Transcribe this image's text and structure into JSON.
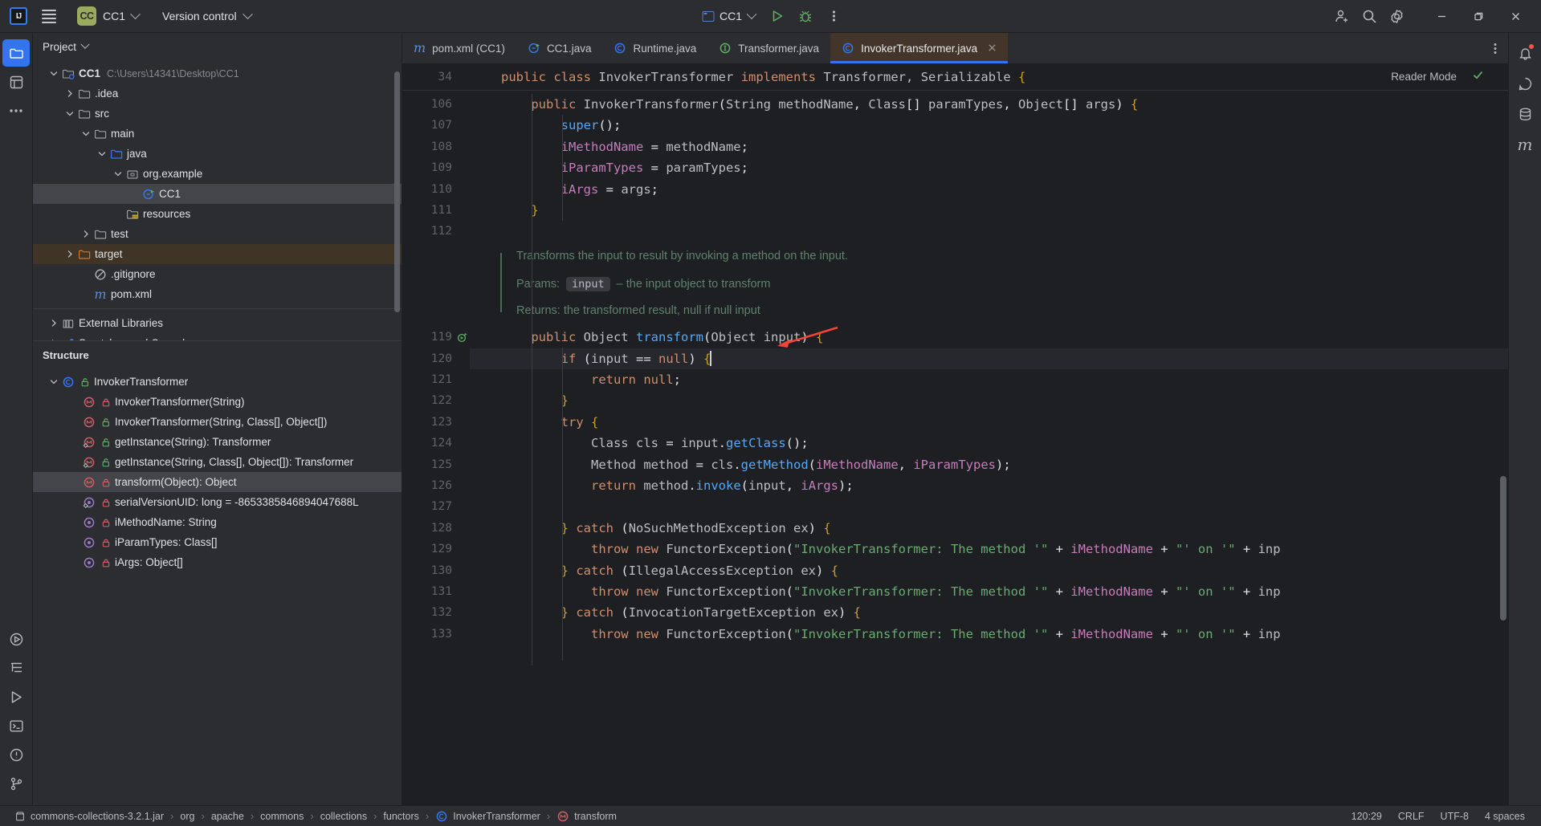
{
  "toolbar": {
    "logo": "intellij-idea-logo",
    "menu_icon": "hamburger-menu-icon",
    "project_badge": "CC",
    "project_name": "CC1",
    "version_control_label": "Version control",
    "run_config_name": "CC1",
    "run_icon": "run-icon",
    "debug_icon": "debug-icon",
    "more_icon": "more-vertical-icon",
    "account_icon": "account-add-icon",
    "search_icon": "search-icon",
    "settings_icon": "gear-icon",
    "minimize_icon": "minimize-icon",
    "maximize_icon": "maximize-icon",
    "close_icon": "close-icon"
  },
  "left_rail": [
    {
      "name": "project-tool-window",
      "icon": "folder-icon",
      "active": true
    },
    {
      "name": "commit-tool-window",
      "icon": "commit-icon",
      "active": false
    },
    {
      "name": "more-tool-windows",
      "icon": "more-horizontal-icon",
      "active": false
    },
    {
      "name": "run-tool-window",
      "icon": "run-circle-icon",
      "active": false
    },
    {
      "name": "structure-tool-window",
      "icon": "structure-icon",
      "active": false
    },
    {
      "name": "services-tool-window",
      "icon": "play-outline-icon",
      "active": false
    },
    {
      "name": "terminal-tool-window",
      "icon": "terminal-icon",
      "active": false
    },
    {
      "name": "problems-tool-window",
      "icon": "warning-circle-icon",
      "active": false
    },
    {
      "name": "version-control-tool-window",
      "icon": "branch-icon",
      "active": false
    }
  ],
  "right_rail": [
    {
      "name": "notifications",
      "icon": "bell-icon"
    },
    {
      "name": "ai-assistant",
      "icon": "ai-assistant-icon"
    },
    {
      "name": "database",
      "icon": "database-icon"
    },
    {
      "name": "maven",
      "icon": "maven-m-icon"
    }
  ],
  "project_panel": {
    "title": "Project",
    "collapse_icon": "chevron-down-icon",
    "tree": [
      {
        "label": "CC1",
        "path": "C:\\Users\\14341\\Desktop\\CC1",
        "depth": 0,
        "arrow": "down",
        "icon": "module-folder-icon",
        "bold": true,
        "state": "normal"
      },
      {
        "label": ".idea",
        "path": "",
        "depth": 1,
        "arrow": "right",
        "icon": "folder-icon",
        "bold": false,
        "state": "normal"
      },
      {
        "label": "src",
        "path": "",
        "depth": 1,
        "arrow": "down",
        "icon": "folder-icon",
        "bold": false,
        "state": "normal"
      },
      {
        "label": "main",
        "path": "",
        "depth": 2,
        "arrow": "down",
        "icon": "folder-icon",
        "bold": false,
        "state": "normal"
      },
      {
        "label": "java",
        "path": "",
        "depth": 3,
        "arrow": "down",
        "icon": "source-folder-icon",
        "bold": false,
        "state": "normal"
      },
      {
        "label": "org.example",
        "path": "",
        "depth": 4,
        "arrow": "down",
        "icon": "package-icon",
        "bold": false,
        "state": "normal"
      },
      {
        "label": "CC1",
        "path": "",
        "depth": 5,
        "arrow": "none",
        "icon": "java-class-runnable-icon",
        "bold": false,
        "state": "selected"
      },
      {
        "label": "resources",
        "path": "",
        "depth": 4,
        "arrow": "none",
        "icon": "resources-folder-icon",
        "bold": false,
        "state": "normal"
      },
      {
        "label": "test",
        "path": "",
        "depth": 2,
        "arrow": "right",
        "icon": "folder-icon",
        "bold": false,
        "state": "normal"
      },
      {
        "label": "target",
        "path": "",
        "depth": 1,
        "arrow": "right",
        "icon": "excluded-folder-icon",
        "bold": false,
        "state": "highlight"
      },
      {
        "label": ".gitignore",
        "path": "",
        "depth": 2,
        "arrow": "none",
        "icon": "gitignore-icon",
        "bold": false,
        "state": "normal"
      },
      {
        "label": "pom.xml",
        "path": "",
        "depth": 2,
        "arrow": "none",
        "icon": "maven-m-icon",
        "bold": false,
        "state": "normal"
      },
      {
        "label": "External Libraries",
        "path": "",
        "depth": 0,
        "arrow": "right",
        "icon": "library-icon",
        "bold": false,
        "state": "normal"
      },
      {
        "label": "Scratches and Consoles",
        "path": "",
        "depth": 0,
        "arrow": "right",
        "icon": "scratches-icon",
        "bold": false,
        "state": "normal"
      }
    ]
  },
  "structure_panel": {
    "title": "Structure",
    "items": [
      {
        "label": "InvokerTransformer",
        "depth": 0,
        "arrow": "down",
        "icon": "class-icon",
        "access": "public-unlocked-icon",
        "state": "normal"
      },
      {
        "label": "InvokerTransformer(String)",
        "depth": 1,
        "arrow": "none",
        "icon": "method-icon",
        "access": "private-locked-icon",
        "state": "normal"
      },
      {
        "label": "InvokerTransformer(String, Class[], Object[])",
        "depth": 1,
        "arrow": "none",
        "icon": "method-icon",
        "access": "public-unlocked-icon",
        "state": "normal"
      },
      {
        "label": "getInstance(String): Transformer",
        "depth": 1,
        "arrow": "none",
        "icon": "static-method-icon",
        "access": "public-unlocked-icon",
        "state": "normal"
      },
      {
        "label": "getInstance(String, Class[], Object[]): Transformer",
        "depth": 1,
        "arrow": "none",
        "icon": "static-method-icon",
        "access": "public-unlocked-icon",
        "state": "normal"
      },
      {
        "label": "transform(Object): Object",
        "depth": 1,
        "arrow": "none",
        "icon": "method-icon",
        "access": "private-locked-icon",
        "state": "selected"
      },
      {
        "label": "serialVersionUID: long = -8653385846894047688L",
        "depth": 1,
        "arrow": "none",
        "icon": "static-field-icon",
        "access": "private-locked-icon",
        "state": "normal"
      },
      {
        "label": "iMethodName: String",
        "depth": 1,
        "arrow": "none",
        "icon": "field-icon",
        "access": "private-locked-icon",
        "state": "normal"
      },
      {
        "label": "iParamTypes: Class[]",
        "depth": 1,
        "arrow": "none",
        "icon": "field-icon",
        "access": "private-locked-icon",
        "state": "normal"
      },
      {
        "label": "iArgs: Object[]",
        "depth": 1,
        "arrow": "none",
        "icon": "field-icon",
        "access": "private-locked-icon",
        "state": "normal"
      }
    ]
  },
  "editor": {
    "tabs": [
      {
        "label": "pom.xml (CC1)",
        "icon": "maven-m-icon",
        "active": false,
        "closable": false
      },
      {
        "label": "CC1.java",
        "icon": "java-class-runnable-icon",
        "active": false,
        "closable": false
      },
      {
        "label": "Runtime.java",
        "icon": "java-class-icon",
        "active": false,
        "closable": false
      },
      {
        "label": "Transformer.java",
        "icon": "java-interface-icon",
        "active": false,
        "closable": false
      },
      {
        "label": "InvokerTransformer.java",
        "icon": "java-class-icon",
        "active": true,
        "closable": true
      }
    ],
    "tab_overflow_icon": "more-vertical-icon",
    "sticky": {
      "line_number": "34",
      "code": "public class InvokerTransformer implements Transformer, Serializable {",
      "reader_mode_label": "Reader Mode",
      "inspection_icon": "checkmark-ok-icon"
    },
    "lines": [
      {
        "num": "106",
        "code": "    public InvokerTransformer(String methodName, Class[] paramTypes, Object[] args) {"
      },
      {
        "num": "107",
        "code": "        super();"
      },
      {
        "num": "108",
        "code": "        iMethodName = methodName;"
      },
      {
        "num": "109",
        "code": "        iParamTypes = paramTypes;"
      },
      {
        "num": "110",
        "code": "        iArgs = args;"
      },
      {
        "num": "111",
        "code": "    }"
      },
      {
        "num": "112",
        "code": ""
      },
      {
        "num": "",
        "code": ""
      },
      {
        "num": "",
        "code": ""
      },
      {
        "num": "",
        "code": ""
      },
      {
        "num": "",
        "code": ""
      },
      {
        "num": "119",
        "code": "    public Object transform(Object input) {"
      },
      {
        "num": "120",
        "code": "        if (input == null) {"
      },
      {
        "num": "121",
        "code": "            return null;"
      },
      {
        "num": "122",
        "code": "        }"
      },
      {
        "num": "123",
        "code": "        try {"
      },
      {
        "num": "124",
        "code": "            Class cls = input.getClass();"
      },
      {
        "num": "125",
        "code": "            Method method = cls.getMethod(iMethodName, iParamTypes);"
      },
      {
        "num": "126",
        "code": "            return method.invoke(input, iArgs);"
      },
      {
        "num": "127",
        "code": ""
      },
      {
        "num": "128",
        "code": "        } catch (NoSuchMethodException ex) {"
      },
      {
        "num": "129",
        "code": "            throw new FunctorException(\"InvokerTransformer: The method '\" + iMethodName + \"' on '\" + inp"
      },
      {
        "num": "130",
        "code": "        } catch (IllegalAccessException ex) {"
      },
      {
        "num": "131",
        "code": "            throw new FunctorException(\"InvokerTransformer: The method '\" + iMethodName + \"' on '\" + inp"
      },
      {
        "num": "132",
        "code": "        } catch (InvocationTargetException ex) {"
      },
      {
        "num": "133",
        "code": "            throw new FunctorException(\"InvokerTransformer: The method '\" + iMethodName + \"' on '\" + inp"
      }
    ],
    "javadoc": {
      "summary": "Transforms the input to result by invoking a method on the input.",
      "params_label": "Params:",
      "param_name": "input",
      "param_desc": "– the input object to transform",
      "returns_text": "Returns: the transformed result, null if null input"
    },
    "run_gutter_line": "119",
    "run_gutter_icon": "run-method-icon"
  },
  "statusbar": {
    "breadcrumb": [
      {
        "label": "commons-collections-3.2.1.jar",
        "icon": "jar-icon"
      },
      {
        "label": "org",
        "icon": ""
      },
      {
        "label": "apache",
        "icon": ""
      },
      {
        "label": "commons",
        "icon": ""
      },
      {
        "label": "collections",
        "icon": ""
      },
      {
        "label": "functors",
        "icon": ""
      },
      {
        "label": "InvokerTransformer",
        "icon": "class-icon"
      },
      {
        "label": "transform",
        "icon": "method-icon"
      }
    ],
    "caret": "120:29",
    "line_separator": "CRLF",
    "encoding": "UTF-8",
    "indent": "4 spaces"
  },
  "colors": {
    "accent": "#3574f0",
    "active_tab_bg": "#43352a",
    "panel_bg": "#2b2d30",
    "editor_bg": "#1e1f22",
    "annotation_arrow": "#f04438"
  }
}
